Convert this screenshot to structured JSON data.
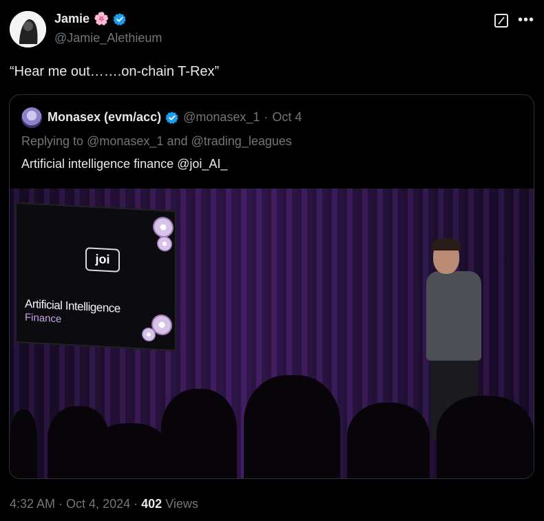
{
  "tweet": {
    "author": {
      "name": "Jamie",
      "emoji": "🌸",
      "handle": "@Jamie_Alethieum",
      "verified": true
    },
    "text": "“Hear me out…….on-chain T-Rex”",
    "timestamp": "4:32 AM · Oct 4, 2024",
    "views_count": "402",
    "views_label": "Views"
  },
  "quote": {
    "author": {
      "name": "Monasex (evm/acc)",
      "handle": "@monasex_1",
      "date": "Oct 4",
      "verified": true
    },
    "reply_prefix": "Replying to",
    "reply_mention_1": "@monasex_1",
    "reply_and": "and",
    "reply_mention_2": "@trading_leagues",
    "text": "Artificial intelligence finance @joi_AI_",
    "media": {
      "screen_logo": "joi",
      "screen_title": "Artificial Intelligence",
      "screen_subtitle": "Finance"
    }
  },
  "icons": {
    "verified": "verified-badge-icon",
    "grok": "grok-icon",
    "more": "more-icon"
  },
  "colors": {
    "background": "#000000",
    "text": "#e7e9ea",
    "muted": "#71767b",
    "verified": "#1d9bf0",
    "border": "#2f3336"
  }
}
